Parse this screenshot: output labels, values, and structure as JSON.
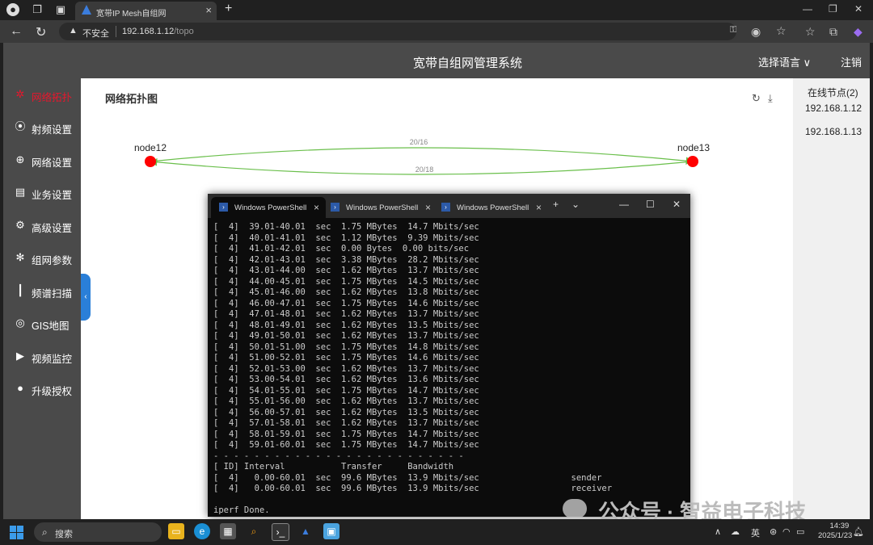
{
  "browser": {
    "tab_title": "宽带IP Mesh自组网",
    "security_label": "不安全",
    "url_host": "192.168.1.12",
    "url_path": "/topo"
  },
  "header": {
    "system_title": "宽带自组网管理系统",
    "language_select": "选择语言",
    "logout": "注销"
  },
  "sidebar": {
    "items": [
      {
        "label": "网络拓扑",
        "icon": "network-topology-icon",
        "active": true
      },
      {
        "label": "射频设置",
        "icon": "antenna-icon",
        "active": false
      },
      {
        "label": "网络设置",
        "icon": "globe-icon",
        "active": false
      },
      {
        "label": "业务设置",
        "icon": "clipboard-icon",
        "active": false
      },
      {
        "label": "高级设置",
        "icon": "gear-icon",
        "active": false
      },
      {
        "label": "组网参数",
        "icon": "mesh-icon",
        "active": false
      },
      {
        "label": "频谱扫描",
        "icon": "spectrum-icon",
        "active": false
      },
      {
        "label": "GIS地图",
        "icon": "map-pin-icon",
        "active": false
      },
      {
        "label": "视频监控",
        "icon": "camera-icon",
        "active": false
      },
      {
        "label": "升级授权",
        "icon": "upgrade-icon",
        "active": false
      }
    ]
  },
  "content": {
    "title": "网络拓扑图",
    "nodes": [
      {
        "name": "node12"
      },
      {
        "name": "node13"
      }
    ],
    "links": [
      {
        "label": "20/16"
      },
      {
        "label": "20/18"
      }
    ]
  },
  "online": {
    "title": "在线节点(2)",
    "nodes": [
      "192.168.1.12",
      "192.168.1.13"
    ]
  },
  "terminal": {
    "tabs": [
      "Windows PowerShell",
      "Windows PowerShell",
      "Windows PowerShell"
    ],
    "lines": [
      "[  4]  39.01-40.01  sec  1.75 MBytes  14.7 Mbits/sec",
      "[  4]  40.01-41.01  sec  1.12 MBytes  9.39 Mbits/sec",
      "[  4]  41.01-42.01  sec  0.00 Bytes  0.00 bits/sec",
      "[  4]  42.01-43.01  sec  3.38 MBytes  28.2 Mbits/sec",
      "[  4]  43.01-44.00  sec  1.62 MBytes  13.7 Mbits/sec",
      "[  4]  44.00-45.01  sec  1.75 MBytes  14.5 Mbits/sec",
      "[  4]  45.01-46.00  sec  1.62 MBytes  13.8 Mbits/sec",
      "[  4]  46.00-47.01  sec  1.75 MBytes  14.6 Mbits/sec",
      "[  4]  47.01-48.01  sec  1.62 MBytes  13.7 Mbits/sec",
      "[  4]  48.01-49.01  sec  1.62 MBytes  13.5 Mbits/sec",
      "[  4]  49.01-50.01  sec  1.62 MBytes  13.7 Mbits/sec",
      "[  4]  50.01-51.00  sec  1.75 MBytes  14.8 Mbits/sec",
      "[  4]  51.00-52.01  sec  1.75 MBytes  14.6 Mbits/sec",
      "[  4]  52.01-53.00  sec  1.62 MBytes  13.7 Mbits/sec",
      "[  4]  53.00-54.01  sec  1.62 MBytes  13.6 Mbits/sec",
      "[  4]  54.01-55.01  sec  1.75 MBytes  14.7 Mbits/sec",
      "[  4]  55.01-56.00  sec  1.62 MBytes  13.7 Mbits/sec",
      "[  4]  56.00-57.01  sec  1.62 MBytes  13.5 Mbits/sec",
      "[  4]  57.01-58.01  sec  1.62 MBytes  13.7 Mbits/sec",
      "[  4]  58.01-59.01  sec  1.75 MBytes  14.7 Mbits/sec",
      "[  4]  59.01-60.01  sec  1.75 MBytes  14.7 Mbits/sec",
      "- - - - - - - - - - - - - - - - - - - - - - - - -",
      "[ ID] Interval           Transfer     Bandwidth",
      "[  4]   0.00-60.01  sec  99.6 MBytes  13.9 Mbits/sec                  sender",
      "[  4]   0.00-60.01  sec  99.6 MBytes  13.9 Mbits/sec                  receiver",
      "",
      "iperf Done."
    ]
  },
  "taskbar": {
    "search_placeholder": "搜索",
    "ime": "英",
    "time": "14:39",
    "date": "2025/1/23"
  },
  "watermark": {
    "text": "公众号 · 智益电子科技"
  },
  "colors": {
    "active_menu": "#e8162c",
    "node": "#ff0000",
    "link": "#6abf4b",
    "sidebar_bg": "#4a4a4a"
  }
}
